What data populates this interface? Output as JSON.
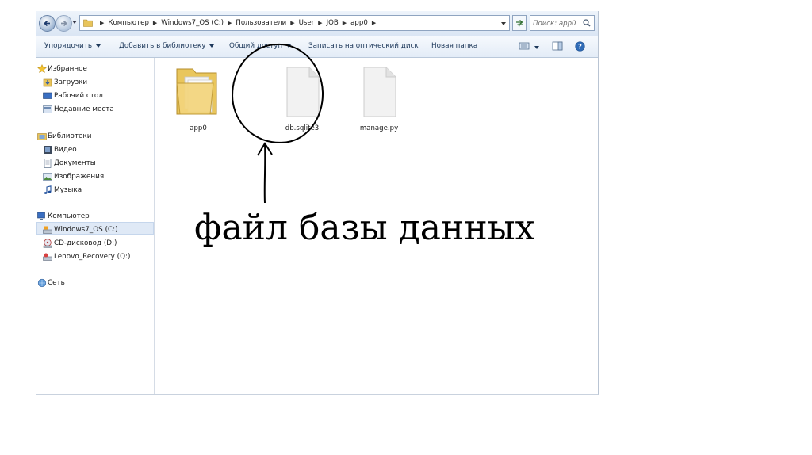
{
  "addressbar": {
    "breadcrumbs": [
      "Компьютер",
      "Windows7_OS (C:)",
      "Пользователи",
      "User",
      "JOB",
      "app0"
    ],
    "search_placeholder": "Поиск: app0"
  },
  "toolbar": {
    "organize": "Упорядочить",
    "add_to_library": "Добавить в библиотеку",
    "share": "Общий доступ",
    "burn": "Записать на оптический диск",
    "new_folder": "Новая папка"
  },
  "sidebar": {
    "favorites": {
      "label": "Избранное",
      "icon": "star-icon",
      "items": [
        {
          "label": "Загрузки",
          "icon": "downloads-icon"
        },
        {
          "label": "Рабочий стол",
          "icon": "desktop-icon"
        },
        {
          "label": "Недавние места",
          "icon": "recent-places-icon"
        }
      ]
    },
    "libraries": {
      "label": "Библиотеки",
      "icon": "libraries-icon",
      "items": [
        {
          "label": "Видео",
          "icon": "video-icon"
        },
        {
          "label": "Документы",
          "icon": "documents-icon"
        },
        {
          "label": "Изображения",
          "icon": "pictures-icon"
        },
        {
          "label": "Музыка",
          "icon": "music-icon"
        }
      ]
    },
    "computer": {
      "label": "Компьютер",
      "icon": "computer-icon",
      "items": [
        {
          "label": "Windows7_OS (C:)",
          "icon": "drive-icon",
          "selected": true
        },
        {
          "label": "CD-дисковод (D:)",
          "icon": "cd-drive-icon"
        },
        {
          "label": "Lenovo_Recovery (Q:)",
          "icon": "drive-icon"
        }
      ]
    },
    "network": {
      "label": "Сеть",
      "icon": "network-icon"
    }
  },
  "files": [
    {
      "name": "app0",
      "type": "folder",
      "icon": "folder-icon"
    },
    {
      "name": "db.sqlite3",
      "type": "file",
      "icon": "file-icon"
    },
    {
      "name": "manage.py",
      "type": "file",
      "icon": "file-icon"
    }
  ],
  "annotation": {
    "text": "файл базы данных"
  },
  "colors": {
    "toolbar_text": "#1e395b",
    "selection": "#dfe9f6"
  }
}
